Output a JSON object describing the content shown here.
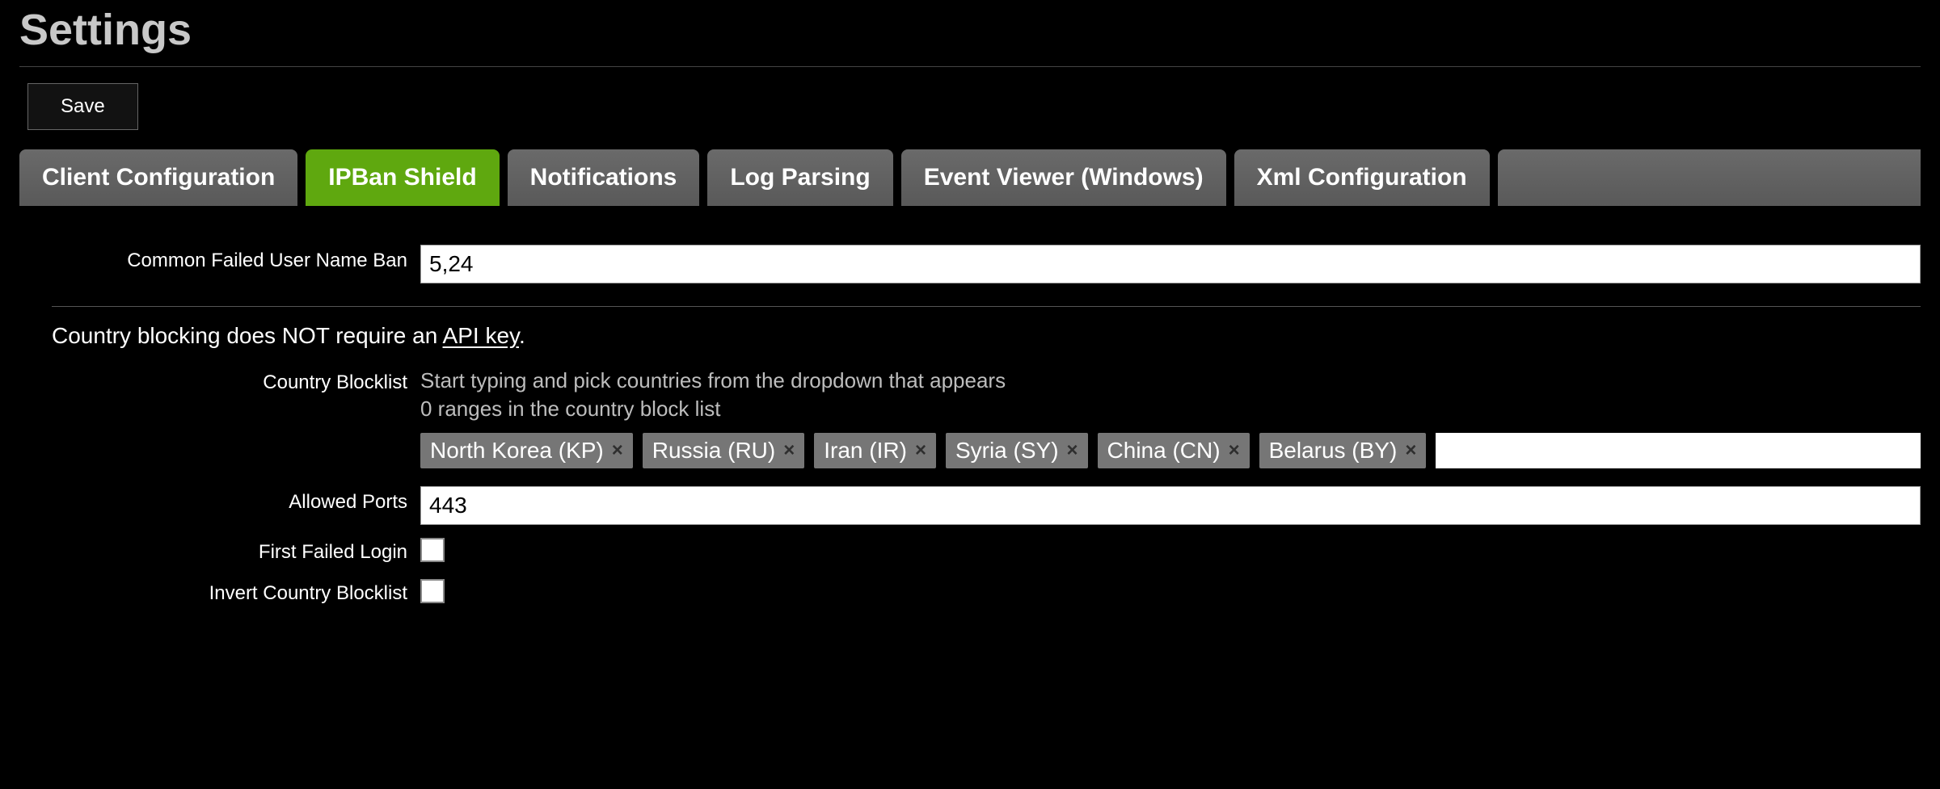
{
  "title": "Settings",
  "save_label": "Save",
  "tabs": [
    {
      "label": "Client Configuration",
      "active": false
    },
    {
      "label": "IPBan Shield",
      "active": true
    },
    {
      "label": "Notifications",
      "active": false
    },
    {
      "label": "Log Parsing",
      "active": false
    },
    {
      "label": "Event Viewer (Windows)",
      "active": false
    },
    {
      "label": "Xml Configuration",
      "active": false
    }
  ],
  "form": {
    "common_failed_user_name_ban": {
      "label": "Common Failed User Name Ban",
      "value": "5,24"
    },
    "country_info_prefix": "Country blocking does NOT require an ",
    "country_info_link": "API key",
    "country_info_suffix": ".",
    "country_blocklist": {
      "label": "Country Blocklist",
      "helper_line1": "Start typing and pick countries from the dropdown that appears",
      "helper_line2": "0 ranges in the country block list",
      "chips": [
        "North Korea (KP)",
        "Russia (RU)",
        "Iran (IR)",
        "Syria (SY)",
        "China (CN)",
        "Belarus (BY)"
      ]
    },
    "allowed_ports": {
      "label": "Allowed Ports",
      "value": "443"
    },
    "first_failed_login": {
      "label": "First Failed Login",
      "checked": false
    },
    "invert_country_blocklist": {
      "label": "Invert Country Blocklist",
      "checked": false
    }
  }
}
